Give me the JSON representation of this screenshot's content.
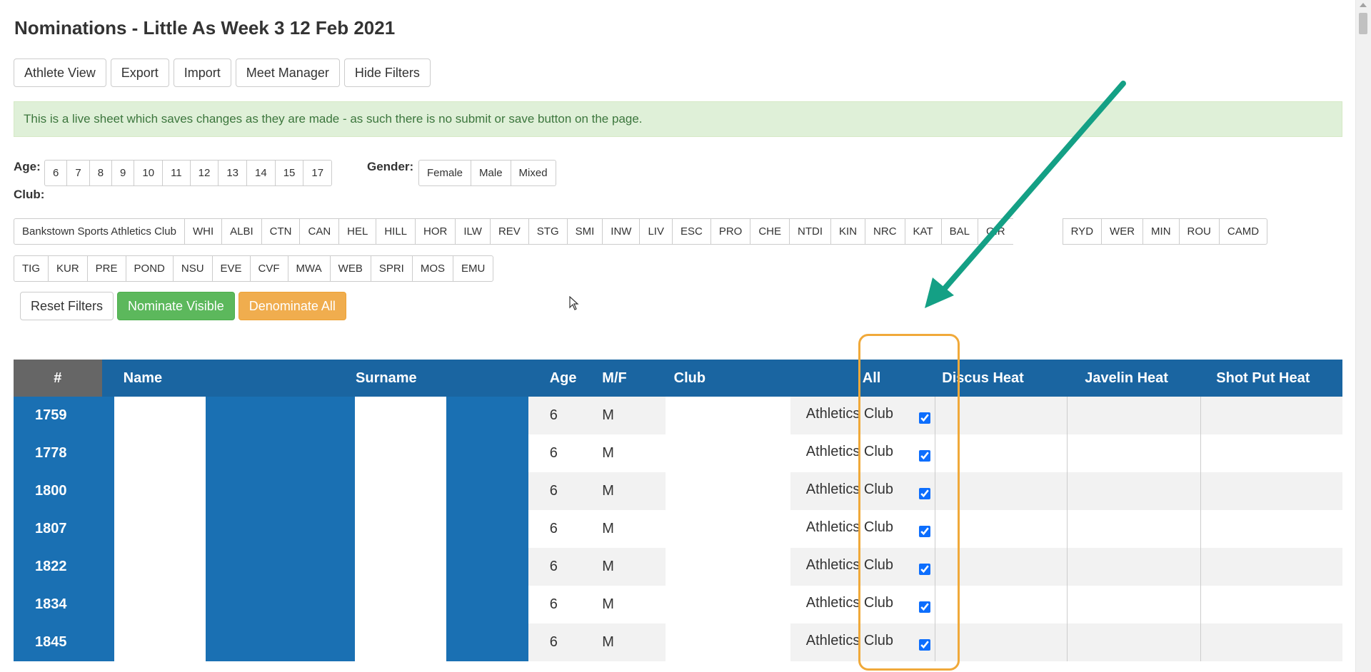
{
  "page": {
    "title": "Nominations - Little As Week 3 12 Feb 2021"
  },
  "toolbar": [
    "Athlete View",
    "Export",
    "Import",
    "Meet Manager",
    "Hide Filters"
  ],
  "alert": "This is a live sheet which saves changes as they are made - as such there is no submit or save button on the page.",
  "filters": {
    "age_label": "Age:",
    "ages": [
      "6",
      "7",
      "8",
      "9",
      "10",
      "11",
      "12",
      "13",
      "14",
      "15",
      "17"
    ],
    "gender_label": "Gender:",
    "genders": [
      "Female",
      "Male",
      "Mixed"
    ],
    "club_label": "Club:",
    "clubs_row1": [
      "Bankstown Sports Athletics Club",
      "WHI",
      "ALBI",
      "CTN",
      "CAN",
      "HEL",
      "HILL",
      "HOR",
      "ILW",
      "REV",
      "STG",
      "SMI",
      "INW",
      "LIV",
      "ESC",
      "PRO",
      "CHE",
      "NTDI",
      "KIN",
      "NRC",
      "KAT",
      "BAL",
      "GIR",
      "",
      "RYD",
      "WER",
      "MIN",
      "ROU",
      "CAMD"
    ],
    "clubs_row2": [
      "TIG",
      "KUR",
      "PRE",
      "POND",
      "NSU",
      "EVE",
      "CVF",
      "MWA",
      "WEB",
      "SPRI",
      "MOS",
      "EMU"
    ]
  },
  "actions": {
    "reset": "Reset Filters",
    "nominate": "Nominate Visible",
    "denominate": "Denominate All"
  },
  "colors": {
    "header_blue": "#1a65a1",
    "cell_blue": "#1a70b3",
    "success": "#5cb85c",
    "warning": "#f0ad4e",
    "arrow": "#14a085",
    "highlight": "#f0a93a"
  },
  "table": {
    "headers": {
      "id": "#",
      "name": "Name",
      "surname": "Surname",
      "age": "Age",
      "mf": "M/F",
      "club": "Club",
      "all": "All",
      "discus": "Discus Heat",
      "javelin": "Javelin Heat",
      "shotput": "Shot Put Heat"
    },
    "rows": [
      {
        "id": "1759",
        "age": "6",
        "mf": "M",
        "club": "Athletics Club",
        "all": true
      },
      {
        "id": "1778",
        "age": "6",
        "mf": "M",
        "club": "Athletics Club",
        "all": true
      },
      {
        "id": "1800",
        "age": "6",
        "mf": "M",
        "club": "Athletics Club",
        "all": true
      },
      {
        "id": "1807",
        "age": "6",
        "mf": "M",
        "club": "Athletics Club",
        "all": true
      },
      {
        "id": "1822",
        "age": "6",
        "mf": "M",
        "club": "Athletics Club",
        "all": true
      },
      {
        "id": "1834",
        "age": "6",
        "mf": "M",
        "club": "Athletics Club",
        "all": true
      },
      {
        "id": "1845",
        "age": "6",
        "mf": "M",
        "club": "Athletics Club",
        "all": true
      }
    ]
  }
}
